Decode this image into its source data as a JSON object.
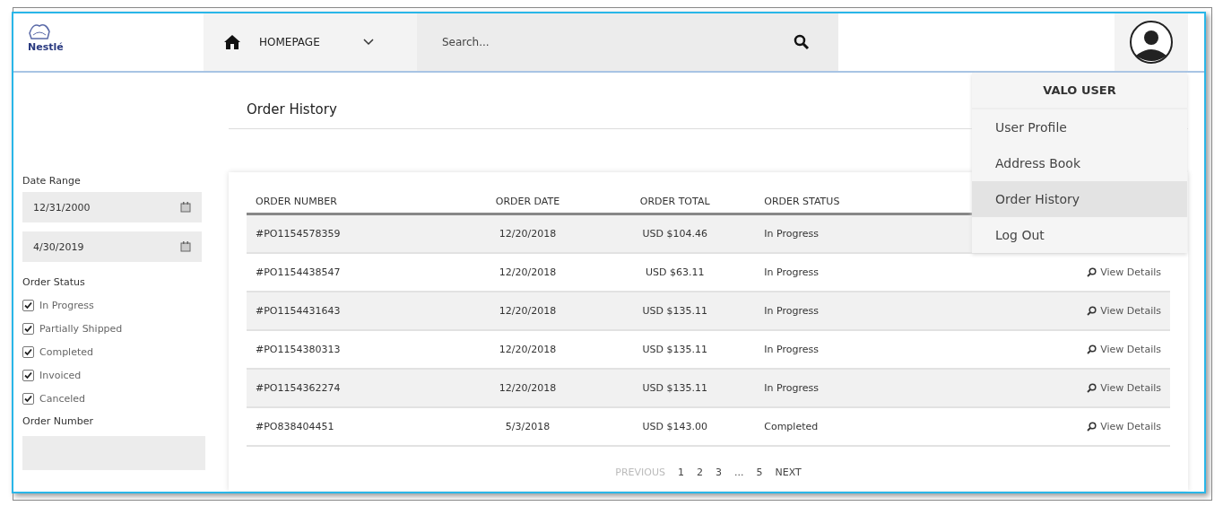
{
  "header": {
    "logo_text": "Nestlé",
    "nav": {
      "label": "HOMEPAGE"
    },
    "search": {
      "placeholder": "Search..."
    }
  },
  "user_menu": {
    "title": "VALO USER",
    "items": [
      {
        "label": "User Profile",
        "selected": false
      },
      {
        "label": "Address Book",
        "selected": false
      },
      {
        "label": "Order History",
        "selected": true
      },
      {
        "label": "Log Out",
        "selected": false
      }
    ]
  },
  "sidebar": {
    "date_range": {
      "label": "Date Range",
      "from": "12/31/2000",
      "to": "4/30/2019"
    },
    "order_status": {
      "label": "Order Status",
      "options": [
        {
          "label": "In Progress",
          "checked": true
        },
        {
          "label": "Partially Shipped",
          "checked": true
        },
        {
          "label": "Completed",
          "checked": true
        },
        {
          "label": "Invoiced",
          "checked": true
        },
        {
          "label": "Canceled",
          "checked": true
        }
      ]
    },
    "order_number": {
      "label": "Order Number"
    }
  },
  "page_title": "Order History",
  "table": {
    "columns": [
      "ORDER NUMBER",
      "ORDER DATE",
      "ORDER TOTAL",
      "ORDER STATUS"
    ],
    "rows": [
      {
        "number": "#PO1154578359",
        "date": "12/20/2018",
        "total": "USD $104.46",
        "status": "In Progress"
      },
      {
        "number": "#PO1154438547",
        "date": "12/20/2018",
        "total": "USD $63.11",
        "status": "In Progress",
        "action": "View Details"
      },
      {
        "number": "#PO1154431643",
        "date": "12/20/2018",
        "total": "USD $135.11",
        "status": "In Progress",
        "action": "View Details"
      },
      {
        "number": "#PO1154380313",
        "date": "12/20/2018",
        "total": "USD $135.11",
        "status": "In Progress",
        "action": "View Details"
      },
      {
        "number": "#PO1154362274",
        "date": "12/20/2018",
        "total": "USD $135.11",
        "status": "In Progress",
        "action": "View Details"
      },
      {
        "number": "#PO838404451",
        "date": "5/3/2018",
        "total": "USD $143.00",
        "status": "Completed",
        "action": "View Details"
      }
    ]
  },
  "pagination": [
    {
      "label": "PREVIOUS",
      "disabled": true
    },
    {
      "label": "1",
      "disabled": false
    },
    {
      "label": "2",
      "disabled": false
    },
    {
      "label": "3",
      "disabled": false
    },
    {
      "label": "...",
      "disabled": false
    },
    {
      "label": "5",
      "disabled": false
    },
    {
      "label": "NEXT",
      "disabled": false
    }
  ]
}
